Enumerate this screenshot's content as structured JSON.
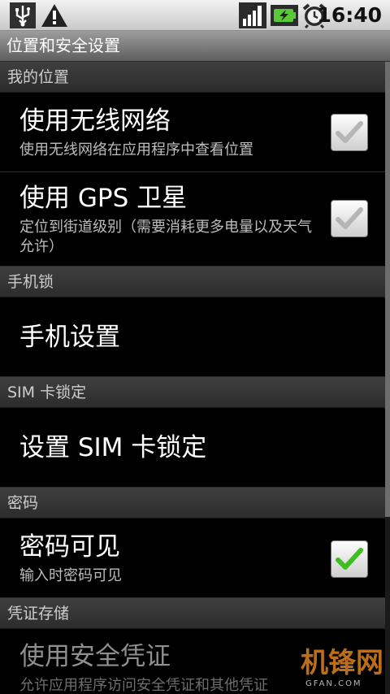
{
  "status_bar": {
    "time": "16:40",
    "icons": [
      "usb-icon",
      "warning-icon",
      "signal-icon",
      "battery-charging-icon",
      "alarm-icon"
    ]
  },
  "title_bar": {
    "title": "位置和安全设置"
  },
  "sections": [
    {
      "header": "我的位置",
      "items": [
        {
          "title": "使用无线网络",
          "summary": "使用无线网络在应用程序中查看位置",
          "checked": true,
          "enabled": false
        },
        {
          "title": "使用 GPS 卫星",
          "summary": "定位到街道级别（需要消耗更多电量以及天气允许）",
          "checked": true,
          "enabled": false
        }
      ]
    },
    {
      "header": "手机锁",
      "items": [
        {
          "title": "手机设置"
        }
      ]
    },
    {
      "header": "SIM 卡锁定",
      "items": [
        {
          "title": "设置 SIM 卡锁定"
        }
      ]
    },
    {
      "header": "密码",
      "items": [
        {
          "title": "密码可见",
          "summary": "输入时密码可见",
          "checked": true,
          "enabled": true
        }
      ]
    },
    {
      "header": "凭证存储",
      "items": [
        {
          "title": "使用安全凭证",
          "summary": "允许应用程序访问安全凭证和其他凭证",
          "enabled": false
        }
      ]
    }
  ],
  "watermark": {
    "text": "机锋网",
    "sub": "GFAN.COM"
  },
  "colors": {
    "check_green": "#3fbf1f",
    "check_gray": "#b5b5b5",
    "watermark": "#d17a1c"
  }
}
